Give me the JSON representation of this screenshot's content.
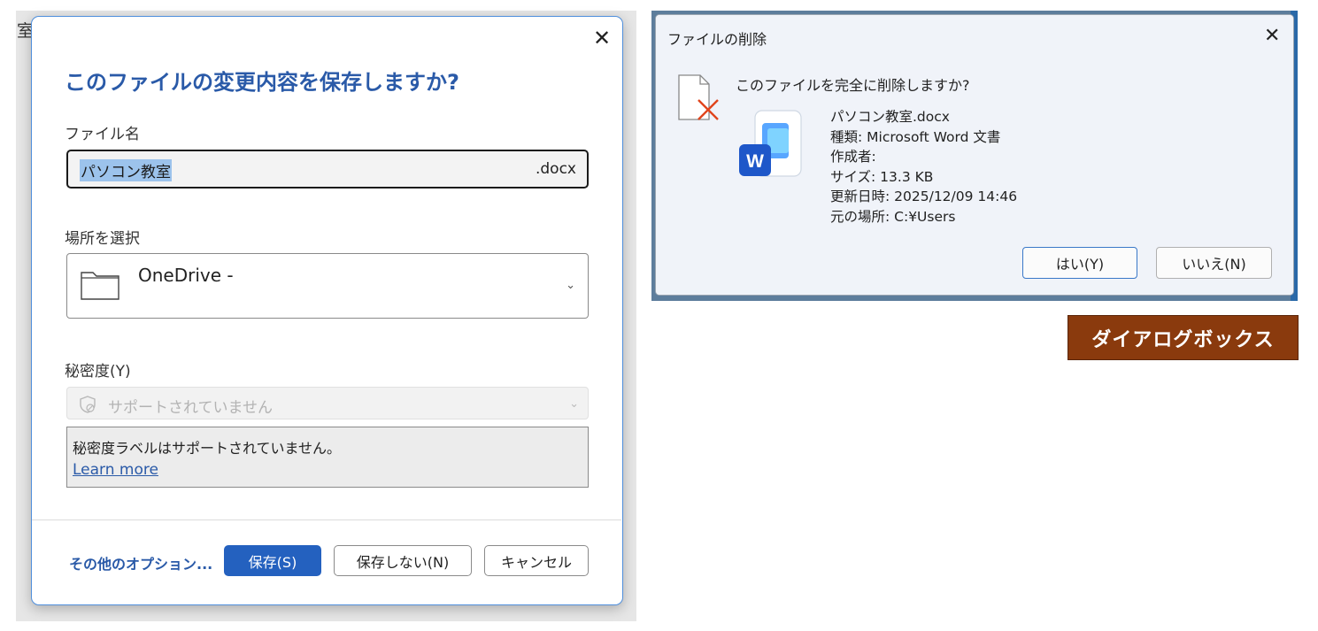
{
  "background_char": "室",
  "save_dialog": {
    "title": "このファイルの変更内容を保存しますか?",
    "close_symbol": "✕",
    "filename_label": "ファイル名",
    "filename_value": "パソコン教室",
    "filename_ext": ".docx",
    "location_label": "場所を選択",
    "location_value": "OneDrive -",
    "sensitivity_label": "秘密度(Y)",
    "sensitivity_value": "サポートされていません",
    "sensitivity_info": "秘密度ラベルはサポートされていません。",
    "learn_more": "Learn more",
    "more_options": "その他のオプション...",
    "save_button": "保存(S)",
    "dont_save_button": "保存しない(N)",
    "cancel_button": "キャンセル"
  },
  "delete_dialog": {
    "title": "ファイルの削除",
    "close_symbol": "✕",
    "question": "このファイルを完全に削除しますか?",
    "file_name": "パソコン教室.docx",
    "file_type": "種類: Microsoft Word 文書",
    "author": "作成者:",
    "size": "サイズ: 13.3 KB",
    "modified": "更新日時: 2025/12/09 14:46",
    "location": "元の場所: C:¥Users",
    "yes_button": "はい(Y)",
    "no_button": "いいえ(N)"
  },
  "caption": "ダイアログボックス",
  "icons": {
    "folder": "folder-icon",
    "shield": "shield-icon",
    "word": "word-icon",
    "document_delete": "document-delete-icon"
  },
  "colors": {
    "accent_blue": "#2461bf",
    "title_blue": "#2a5aa8",
    "caption_brown": "#8a3a0d",
    "delete_red": "#e0441c"
  }
}
